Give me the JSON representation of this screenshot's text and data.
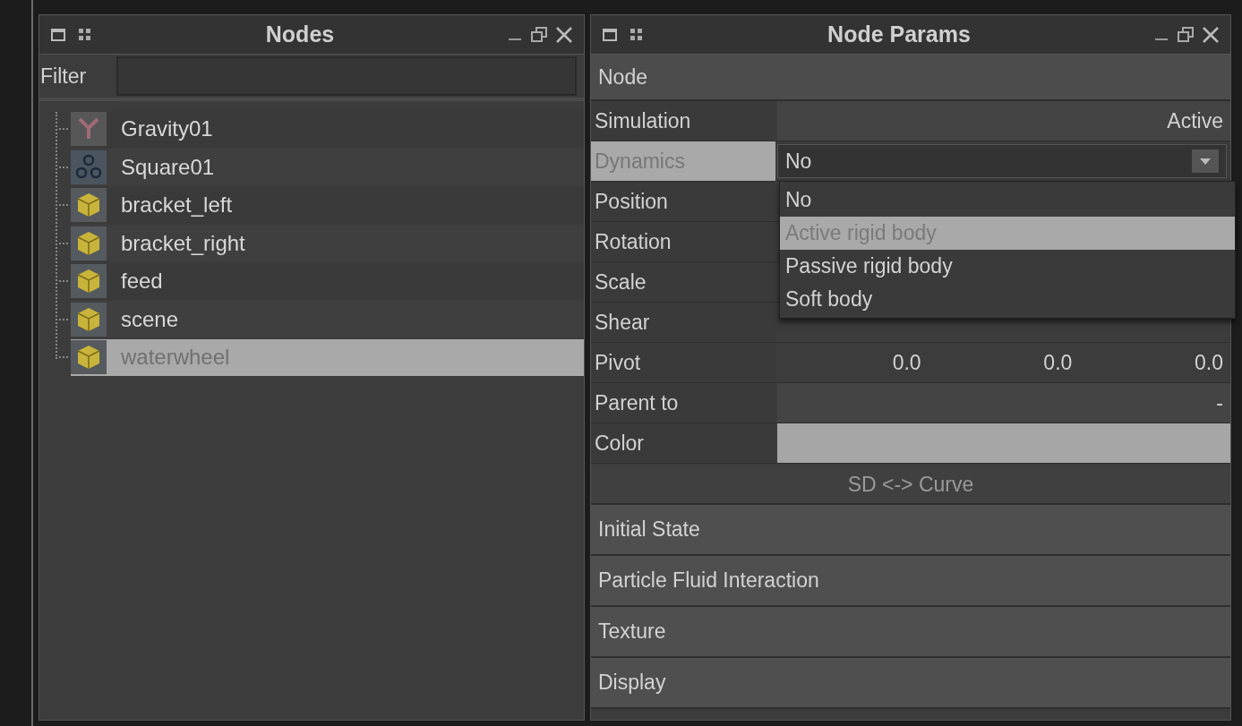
{
  "nodes_panel": {
    "title": "Nodes",
    "filter": {
      "label": "Filter"
    },
    "tree": [
      {
        "label": "Gravity01",
        "kind": "gravity",
        "selected": false
      },
      {
        "label": "Square01",
        "kind": "particles",
        "selected": false
      },
      {
        "label": "bracket_left",
        "kind": "mesh",
        "selected": false
      },
      {
        "label": "bracket_right",
        "kind": "mesh",
        "selected": false
      },
      {
        "label": "feed",
        "kind": "mesh",
        "selected": false
      },
      {
        "label": "scene",
        "kind": "mesh",
        "selected": false
      },
      {
        "label": "waterwheel",
        "kind": "mesh",
        "selected": true
      }
    ]
  },
  "params_panel": {
    "title": "Node Params",
    "sections": [
      {
        "title": "Node",
        "expanded": true,
        "rows": [
          {
            "label": "Simulation",
            "kind": "text",
            "selected": false,
            "value": "Active"
          },
          {
            "label": "Dynamics",
            "kind": "dropdown",
            "selected": true,
            "value": "No",
            "open": true,
            "options": [
              {
                "label": "No",
                "highlighted": false
              },
              {
                "label": "Active rigid body",
                "highlighted": true
              },
              {
                "label": "Passive rigid body",
                "highlighted": false
              },
              {
                "label": "Soft body",
                "highlighted": false
              }
            ]
          },
          {
            "label": "Position",
            "kind": "hidden",
            "selected": false
          },
          {
            "label": "Rotation",
            "kind": "hidden",
            "selected": false
          },
          {
            "label": "Scale",
            "kind": "hidden",
            "selected": false
          },
          {
            "label": "Shear",
            "kind": "hidden",
            "selected": false
          },
          {
            "label": "Pivot",
            "kind": "vector",
            "selected": false,
            "values": [
              "0.0",
              "0.0",
              "0.0"
            ]
          },
          {
            "label": "Parent to",
            "kind": "text",
            "selected": false,
            "value": "-"
          },
          {
            "label": "Color",
            "kind": "color",
            "selected": false,
            "color": "#a6a6a6"
          }
        ],
        "button": "SD <-> Curve"
      },
      {
        "title": "Initial State",
        "expanded": false
      },
      {
        "title": "Particle Fluid Interaction",
        "expanded": false
      },
      {
        "title": "Texture",
        "expanded": false
      },
      {
        "title": "Display",
        "expanded": false
      }
    ]
  }
}
